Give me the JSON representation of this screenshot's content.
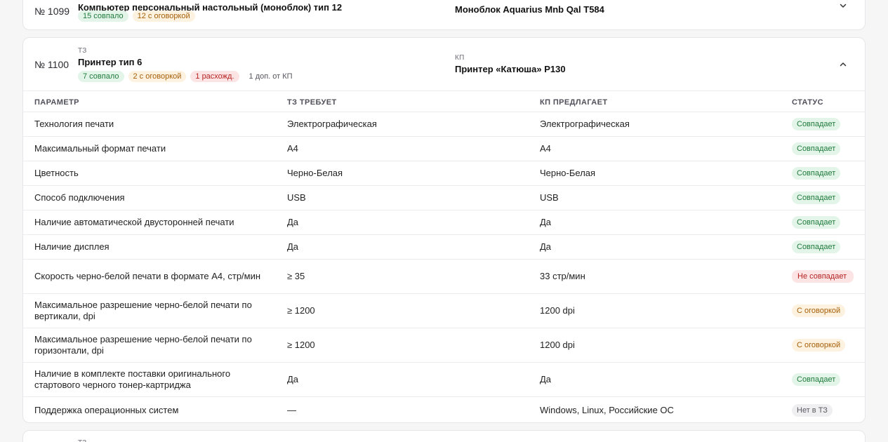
{
  "prev_item": {
    "number": "№ 1099",
    "title": "Компьютер персональный настольный (моноблок) тип 12",
    "badges": {
      "ok": "15 совпало",
      "warn": "12 с оговоркой"
    },
    "kp_title": "Моноблок Aquarius Mnb Qal T584"
  },
  "item": {
    "number": "№ 1100",
    "tz_label": "ТЗ",
    "title": "Принтер тип 6",
    "badges": {
      "ok": "7 совпало",
      "warn": "2 с оговоркой",
      "bad": "1 расхожд."
    },
    "extra": "1 доп. от КП",
    "kp_label": "КП",
    "kp_title": "Принтер «Катюша» P130",
    "columns": [
      "ПАРАМЕТР",
      "ТЗ ТРЕБУЕТ",
      "КП ПРЕДЛАГАЕТ",
      "СТАТУС"
    ],
    "rows": [
      {
        "param": "Технология печати",
        "tz": "Электрографическая",
        "kp": "Электрографическая",
        "status": "Совпадает",
        "kind": "ok"
      },
      {
        "param": "Максимальный формат печати",
        "tz": "A4",
        "kp": "A4",
        "status": "Совпадает",
        "kind": "ok"
      },
      {
        "param": "Цветность",
        "tz": "Черно-Белая",
        "kp": "Черно-Белая",
        "status": "Совпадает",
        "kind": "ok"
      },
      {
        "param": "Способ подключения",
        "tz": "USB",
        "kp": "USB",
        "status": "Совпадает",
        "kind": "ok"
      },
      {
        "param": "Наличие автоматической двусторонней печати",
        "tz": "Да",
        "kp": "Да",
        "status": "Совпадает",
        "kind": "ok"
      },
      {
        "param": "Наличие дисплея",
        "tz": "Да",
        "kp": "Да",
        "status": "Совпадает",
        "kind": "ok"
      },
      {
        "param": "Скорость черно-белой печати в формате А4, стр/мин",
        "tz": "≥ 35",
        "kp": "33 стр/мин",
        "status": "Не совпадает",
        "kind": "bad"
      },
      {
        "param": "Максимальное разрешение черно-белой печати по вертикали, dpi",
        "tz": "≥ 1200",
        "kp": "1200 dpi",
        "status": "С оговоркой",
        "kind": "warn"
      },
      {
        "param": "Максимальное разрешение черно-белой печати по горизонтали, dpi",
        "tz": "≥ 1200",
        "kp": "1200 dpi",
        "status": "С оговоркой",
        "kind": "warn"
      },
      {
        "param": "Наличие в комплекте поставки оригинального стартового черного тонер-картриджа",
        "tz": "Да",
        "kp": "Да",
        "status": "Совпадает",
        "kind": "ok"
      },
      {
        "param": "Поддержка операционных систем",
        "tz": "—",
        "kp": "Windows, Linux, Российские ОС",
        "status": "Нет в ТЗ",
        "kind": "na"
      }
    ]
  },
  "next_item": {
    "tz_label": "ТЗ"
  }
}
